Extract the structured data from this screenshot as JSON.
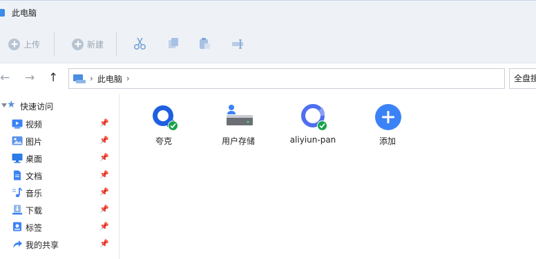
{
  "window": {
    "title": "此电脑"
  },
  "toolbar": {
    "upload_label": "上传",
    "new_label": "新建",
    "icons": [
      "cut-icon",
      "copy-icon",
      "paste-icon",
      "rename-icon"
    ]
  },
  "address": {
    "crumb": "此电脑",
    "search_text": "全盘搜"
  },
  "sidebar": {
    "quick_access": "快速访问",
    "items": [
      {
        "label": "视频",
        "icon": "video-icon",
        "color": "#3b82f6"
      },
      {
        "label": "图片",
        "icon": "picture-icon",
        "color": "#3b82f6"
      },
      {
        "label": "桌面",
        "icon": "desktop-icon",
        "color": "#2d7be5"
      },
      {
        "label": "文档",
        "icon": "document-icon",
        "color": "#3b82f6"
      },
      {
        "label": "音乐",
        "icon": "music-icon",
        "color": "#3b82f6"
      },
      {
        "label": "下载",
        "icon": "download-icon",
        "color": "#3b82f6"
      },
      {
        "label": "标签",
        "icon": "tag-icon",
        "color": "#3b82f6"
      },
      {
        "label": "我的共享",
        "icon": "share-icon",
        "color": "#3b82f6"
      }
    ]
  },
  "drives": [
    {
      "label": "夸克",
      "icon": "quark-icon",
      "status": "connected"
    },
    {
      "label": "用户存储",
      "icon": "user-storage-icon",
      "status": ""
    },
    {
      "label": "aliyiun-pan",
      "icon": "aliyun-pan-icon",
      "status": "connected"
    },
    {
      "label": "添加",
      "icon": "add-icon",
      "status": ""
    }
  ],
  "colors": {
    "accent": "#3b82f6",
    "check": "#16a34a",
    "toolbar_bg": "#eef2f7"
  }
}
